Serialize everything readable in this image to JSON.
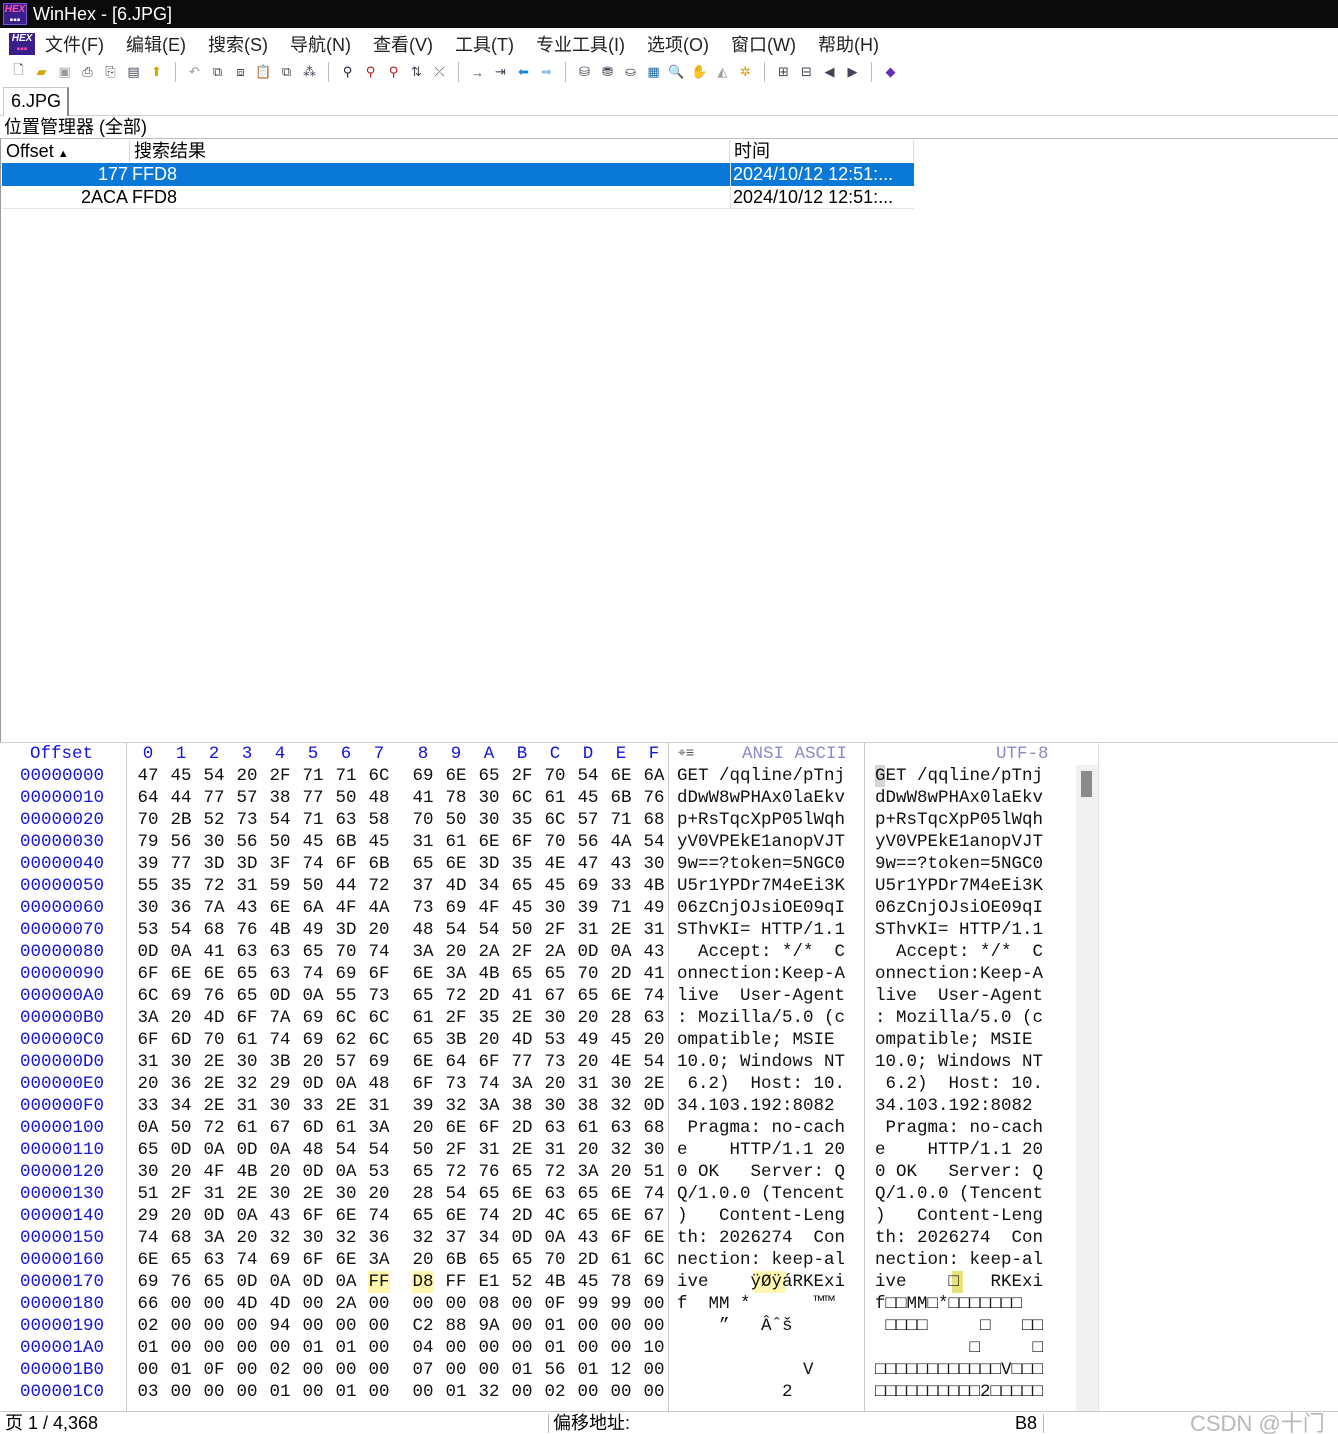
{
  "window": {
    "title": "WinHex - [6.JPG]",
    "icon": "winhex-logo-icon"
  },
  "menu": [
    "文件(F)",
    "编辑(E)",
    "搜索(S)",
    "导航(N)",
    "查看(V)",
    "工具(T)",
    "专业工具(I)",
    "选项(O)",
    "窗口(W)",
    "帮助(H)"
  ],
  "file_tab": "6.JPG",
  "position_manager": {
    "title": "位置管理器 (全部)",
    "columns": [
      "Offset",
      "搜索结果",
      "时间"
    ],
    "rows": [
      {
        "offset": "177",
        "result": "FFD8",
        "time": "2024/10/12  12:51:..."
      },
      {
        "offset": "2ACA",
        "result": "FFD8",
        "time": "2024/10/12  12:51:..."
      }
    ]
  },
  "hex": {
    "offset_label": "Offset",
    "columns": [
      "0",
      "1",
      "2",
      "3",
      "4",
      "5",
      "6",
      "7",
      "8",
      "9",
      "A",
      "B",
      "C",
      "D",
      "E",
      "F"
    ],
    "ansi_label": "ANSI ASCII",
    "utf_label": "UTF-8",
    "rows": [
      {
        "offset": "00000000",
        "bytes": [
          "47",
          "45",
          "54",
          "20",
          "2F",
          "71",
          "71",
          "6C",
          "69",
          "6E",
          "65",
          "2F",
          "70",
          "54",
          "6E",
          "6A"
        ],
        "ansi": "GET /qqline/pTnj",
        "utf": "GET /qqline/pTnj"
      },
      {
        "offset": "00000010",
        "bytes": [
          "64",
          "44",
          "77",
          "57",
          "38",
          "77",
          "50",
          "48",
          "41",
          "78",
          "30",
          "6C",
          "61",
          "45",
          "6B",
          "76"
        ],
        "ansi": "dDwW8wPHAx0laEkv",
        "utf": "dDwW8wPHAx0laEkv"
      },
      {
        "offset": "00000020",
        "bytes": [
          "70",
          "2B",
          "52",
          "73",
          "54",
          "71",
          "63",
          "58",
          "70",
          "50",
          "30",
          "35",
          "6C",
          "57",
          "71",
          "68"
        ],
        "ansi": "p+RsTqcXpP05lWqh",
        "utf": "p+RsTqcXpP05lWqh"
      },
      {
        "offset": "00000030",
        "bytes": [
          "79",
          "56",
          "30",
          "56",
          "50",
          "45",
          "6B",
          "45",
          "31",
          "61",
          "6E",
          "6F",
          "70",
          "56",
          "4A",
          "54"
        ],
        "ansi": "yV0VPEkE1anopVJT",
        "utf": "yV0VPEkE1anopVJT"
      },
      {
        "offset": "00000040",
        "bytes": [
          "39",
          "77",
          "3D",
          "3D",
          "3F",
          "74",
          "6F",
          "6B",
          "65",
          "6E",
          "3D",
          "35",
          "4E",
          "47",
          "43",
          "30"
        ],
        "ansi": "9w==?token=5NGC0",
        "utf": "9w==?token=5NGC0"
      },
      {
        "offset": "00000050",
        "bytes": [
          "55",
          "35",
          "72",
          "31",
          "59",
          "50",
          "44",
          "72",
          "37",
          "4D",
          "34",
          "65",
          "45",
          "69",
          "33",
          "4B"
        ],
        "ansi": "U5r1YPDr7M4eEi3K",
        "utf": "U5r1YPDr7M4eEi3K"
      },
      {
        "offset": "00000060",
        "bytes": [
          "30",
          "36",
          "7A",
          "43",
          "6E",
          "6A",
          "4F",
          "4A",
          "73",
          "69",
          "4F",
          "45",
          "30",
          "39",
          "71",
          "49"
        ],
        "ansi": "06zCnjOJsiOE09qI",
        "utf": "06zCnjOJsiOE09qI"
      },
      {
        "offset": "00000070",
        "bytes": [
          "53",
          "54",
          "68",
          "76",
          "4B",
          "49",
          "3D",
          "20",
          "48",
          "54",
          "54",
          "50",
          "2F",
          "31",
          "2E",
          "31"
        ],
        "ansi": "SThvKI= HTTP/1.1",
        "utf": "SThvKI= HTTP/1.1"
      },
      {
        "offset": "00000080",
        "bytes": [
          "0D",
          "0A",
          "41",
          "63",
          "63",
          "65",
          "70",
          "74",
          "3A",
          "20",
          "2A",
          "2F",
          "2A",
          "0D",
          "0A",
          "43"
        ],
        "ansi": "  Accept: */*  C",
        "utf": "  Accept: */*  C"
      },
      {
        "offset": "00000090",
        "bytes": [
          "6F",
          "6E",
          "6E",
          "65",
          "63",
          "74",
          "69",
          "6F",
          "6E",
          "3A",
          "4B",
          "65",
          "65",
          "70",
          "2D",
          "41"
        ],
        "ansi": "onnection:Keep-A",
        "utf": "onnection:Keep-A"
      },
      {
        "offset": "000000A0",
        "bytes": [
          "6C",
          "69",
          "76",
          "65",
          "0D",
          "0A",
          "55",
          "73",
          "65",
          "72",
          "2D",
          "41",
          "67",
          "65",
          "6E",
          "74"
        ],
        "ansi": "live  User-Agent",
        "utf": "live  User-Agent"
      },
      {
        "offset": "000000B0",
        "bytes": [
          "3A",
          "20",
          "4D",
          "6F",
          "7A",
          "69",
          "6C",
          "6C",
          "61",
          "2F",
          "35",
          "2E",
          "30",
          "20",
          "28",
          "63"
        ],
        "ansi": ": Mozilla/5.0 (c",
        "utf": ": Mozilla/5.0 (c"
      },
      {
        "offset": "000000C0",
        "bytes": [
          "6F",
          "6D",
          "70",
          "61",
          "74",
          "69",
          "62",
          "6C",
          "65",
          "3B",
          "20",
          "4D",
          "53",
          "49",
          "45",
          "20"
        ],
        "ansi": "ompatible; MSIE ",
        "utf": "ompatible; MSIE "
      },
      {
        "offset": "000000D0",
        "bytes": [
          "31",
          "30",
          "2E",
          "30",
          "3B",
          "20",
          "57",
          "69",
          "6E",
          "64",
          "6F",
          "77",
          "73",
          "20",
          "4E",
          "54"
        ],
        "ansi": "10.0; Windows NT",
        "utf": "10.0; Windows NT"
      },
      {
        "offset": "000000E0",
        "bytes": [
          "20",
          "36",
          "2E",
          "32",
          "29",
          "0D",
          "0A",
          "48",
          "6F",
          "73",
          "74",
          "3A",
          "20",
          "31",
          "30",
          "2E"
        ],
        "ansi": " 6.2)  Host: 10.",
        "utf": " 6.2)  Host: 10."
      },
      {
        "offset": "000000F0",
        "bytes": [
          "33",
          "34",
          "2E",
          "31",
          "30",
          "33",
          "2E",
          "31",
          "39",
          "32",
          "3A",
          "38",
          "30",
          "38",
          "32",
          "0D"
        ],
        "ansi": "34.103.192:8082 ",
        "utf": "34.103.192:8082 "
      },
      {
        "offset": "00000100",
        "bytes": [
          "0A",
          "50",
          "72",
          "61",
          "67",
          "6D",
          "61",
          "3A",
          "20",
          "6E",
          "6F",
          "2D",
          "63",
          "61",
          "63",
          "68"
        ],
        "ansi": " Pragma: no-cach",
        "utf": " Pragma: no-cach"
      },
      {
        "offset": "00000110",
        "bytes": [
          "65",
          "0D",
          "0A",
          "0D",
          "0A",
          "48",
          "54",
          "54",
          "50",
          "2F",
          "31",
          "2E",
          "31",
          "20",
          "32",
          "30"
        ],
        "ansi": "e    HTTP/1.1 20",
        "utf": "e    HTTP/1.1 20"
      },
      {
        "offset": "00000120",
        "bytes": [
          "30",
          "20",
          "4F",
          "4B",
          "20",
          "0D",
          "0A",
          "53",
          "65",
          "72",
          "76",
          "65",
          "72",
          "3A",
          "20",
          "51"
        ],
        "ansi": "0 OK   Server: Q",
        "utf": "0 OK   Server: Q"
      },
      {
        "offset": "00000130",
        "bytes": [
          "51",
          "2F",
          "31",
          "2E",
          "30",
          "2E",
          "30",
          "20",
          "28",
          "54",
          "65",
          "6E",
          "63",
          "65",
          "6E",
          "74"
        ],
        "ansi": "Q/1.0.0 (Tencent",
        "utf": "Q/1.0.0 (Tencent"
      },
      {
        "offset": "00000140",
        "bytes": [
          "29",
          "20",
          "0D",
          "0A",
          "43",
          "6F",
          "6E",
          "74",
          "65",
          "6E",
          "74",
          "2D",
          "4C",
          "65",
          "6E",
          "67"
        ],
        "ansi": ")   Content-Leng",
        "utf": ")   Content-Leng"
      },
      {
        "offset": "00000150",
        "bytes": [
          "74",
          "68",
          "3A",
          "20",
          "32",
          "30",
          "32",
          "36",
          "32",
          "37",
          "34",
          "0D",
          "0A",
          "43",
          "6F",
          "6E"
        ],
        "ansi": "th: 2026274  Con",
        "utf": "th: 2026274  Con"
      },
      {
        "offset": "00000160",
        "bytes": [
          "6E",
          "65",
          "63",
          "74",
          "69",
          "6F",
          "6E",
          "3A",
          "20",
          "6B",
          "65",
          "65",
          "70",
          "2D",
          "61",
          "6C"
        ],
        "ansi": "nection: keep-al",
        "utf": "nection: keep-al"
      },
      {
        "offset": "00000170",
        "bytes": [
          "69",
          "76",
          "65",
          "0D",
          "0A",
          "0D",
          "0A",
          "FF",
          "D8",
          "FF",
          "E1",
          "52",
          "4B",
          "45",
          "78",
          "69"
        ],
        "ansi": "ive    ÿØÿáRKExi",
        "utf": "ive    □   RKExi"
      },
      {
        "offset": "00000180",
        "bytes": [
          "66",
          "00",
          "00",
          "4D",
          "4D",
          "00",
          "2A",
          "00",
          "00",
          "00",
          "08",
          "00",
          "0F",
          "99",
          "99",
          "00"
        ],
        "ansi": "f  MM *      ™™ ",
        "utf": "f□□MM□*□□□□□□□"
      },
      {
        "offset": "00000190",
        "bytes": [
          "02",
          "00",
          "00",
          "00",
          "94",
          "00",
          "00",
          "00",
          "C2",
          "88",
          "9A",
          "00",
          "01",
          "00",
          "00",
          "00"
        ],
        "ansi": "    ”   Âˆš     ",
        "utf": " □□□□     □   □□"
      },
      {
        "offset": "000001A0",
        "bytes": [
          "01",
          "00",
          "00",
          "00",
          "00",
          "01",
          "01",
          "00",
          "04",
          "00",
          "00",
          "00",
          "01",
          "00",
          "00",
          "10"
        ],
        "ansi": "                ",
        "utf": "         □     □"
      },
      {
        "offset": "000001B0",
        "bytes": [
          "00",
          "01",
          "0F",
          "00",
          "02",
          "00",
          "00",
          "00",
          "07",
          "00",
          "00",
          "01",
          "56",
          "01",
          "12",
          "00"
        ],
        "ansi": "            V   ",
        "utf": "□□□□□□□□□□□□V□□□"
      },
      {
        "offset": "000001C0",
        "bytes": [
          "03",
          "00",
          "00",
          "00",
          "01",
          "00",
          "01",
          "00",
          "00",
          "01",
          "32",
          "00",
          "02",
          "00",
          "00",
          "00"
        ],
        "ansi": "          2     ",
        "utf": "□□□□□□□□□□2□□□□□"
      }
    ]
  },
  "status": {
    "page": "页 1 / 4,368",
    "offset_label": "偏移地址:",
    "value": "B8",
    "watermark": "CSDN @十门"
  }
}
